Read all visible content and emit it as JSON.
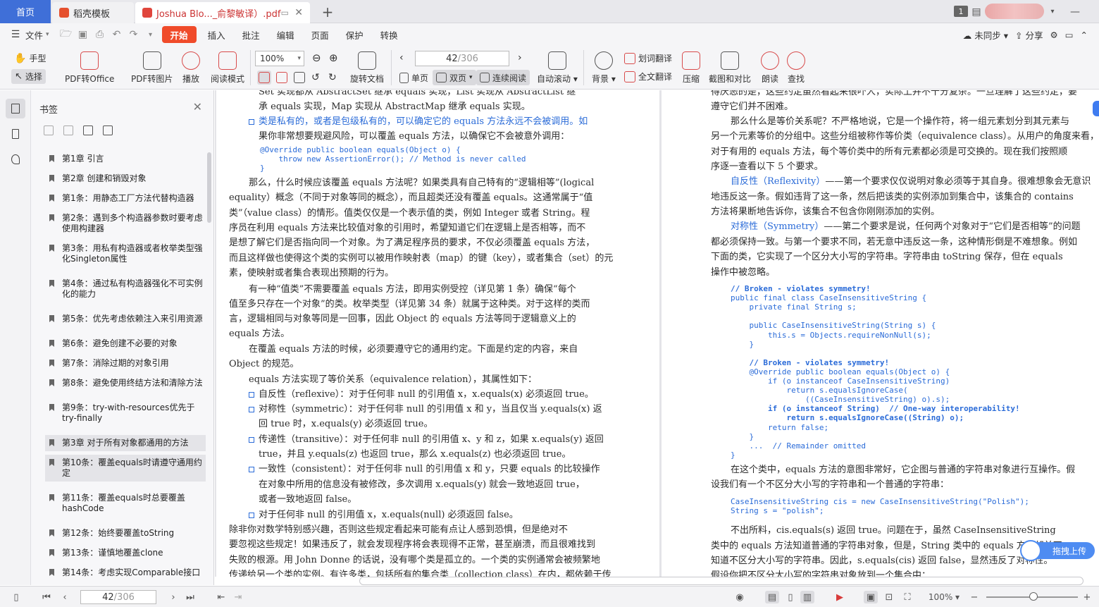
{
  "tabs": {
    "home": "首页",
    "templates": "稻壳模板",
    "document": "Joshua Blo..._俞黎敏译）.pdf",
    "window_count": "1"
  },
  "menu": {
    "file": "文件",
    "items": [
      "开始",
      "插入",
      "批注",
      "编辑",
      "页面",
      "保护",
      "转换"
    ],
    "active": "开始",
    "sync": "未同步",
    "share": "分享"
  },
  "ribbon": {
    "hand": "手型",
    "select": "选择",
    "pdf_to_office": "PDF转Office",
    "pdf_to_image": "PDF转图片",
    "play": "播放",
    "read_mode": "阅读模式",
    "zoom": "100%",
    "rotate": "旋转文档",
    "single": "单页",
    "double": "双页",
    "continuous": "连续阅读",
    "auto_scroll": "自动滚动",
    "background": "背景",
    "word_translate": "划词翻译",
    "full_translate": "全文翻译",
    "compress": "压缩",
    "screenshot": "截图和对比",
    "read_aloud": "朗读",
    "find": "查找",
    "page_current": "42",
    "page_total": "/306"
  },
  "bookmarks": {
    "title": "书签",
    "items": [
      "第1章 引言",
      "第2章 创建和销毁对象",
      "第1条：用静态工厂方法代替构造器",
      "第2条：遇到多个构造器参数时要考虑使用构建器",
      "第3条：用私有构造器或者枚举类型强化Singleton属性",
      "第4条：通过私有构造器强化不可实例化的能力",
      "第5条：优先考虑依赖注入来引用资源",
      "第6条：避免创建不必要的对象",
      "第7条：消除过期的对象引用",
      "第8条：避免使用终结方法和清除方法",
      "第9条：try-with-resources优先于try-finally",
      "第3章 对于所有对象都通用的方法",
      "第10条：覆盖equals时请遵守通用约定",
      "第11条：覆盖equals时总要覆盖hashCode",
      "第12条：始终要覆盖toString",
      "第13条：谨慎地覆盖clone",
      "第14条：考虑实现Comparable接口"
    ],
    "selected_index": 12
  },
  "left_page": {
    "lines": [
      "Set 实现都从 AbstractSet 继承 equals 实现，List 实现从 AbstractList 继",
      "承 equals 实现，Map 实现从 AbstractMap 继承 equals 实现。",
      "类是私有的，或者是包级私有的，可以确定它的 equals 方法永远不会被调用。如",
      "果你非常想要规避风险，可以覆盖 equals 方法，以确保它不会被意外调用：",
      "那么，什么时候应该覆盖 equals 方法呢？如果类具有自己特有的“逻辑相等”(logical",
      "equality）概念（不同于对象等同的概念），而且超类还没有覆盖 equals。这通常属于“值",
      "类”（value class）的情形。值类仅仅是一个表示值的类，例如 Integer 或者 String。程",
      "序员在利用 equals 方法来比较值对象的引用时，希望知道它们在逻辑上是否相等，而不",
      "是想了解它们是否指向同一个对象。为了满足程序员的要求，不仅必须覆盖 equals 方法，",
      "而且这样做也使得这个类的实例可以被用作映射表（map）的键（key），或者集合（set）的元",
      "素，使映射或者集合表现出预期的行为。",
      "有一种“值类”不需要覆盖 equals 方法，即用实例受控（详见第 1 条）确保“每个",
      "值至多只存在一个对象”的类。枚举类型（详见第 34 条）就属于这种类。对于这样的类而",
      "言，逻辑相同与对象等同是一回事，因此 Object 的 equals 方法等同于逻辑意义上的",
      "equals 方法。",
      "在覆盖 equals 方法的时候，必须要遵守它的通用约定。下面是约定的内容，来自",
      "Object 的规范。",
      "equals 方法实现了等价关系（equivalence relation），其属性如下：",
      "自反性（reflexive）：对于任何非 null 的引用值 x，x.equals(x) 必须返回 true。",
      "对称性（symmetric）：对于任何非 null 的引用值 x 和 y，当且仅当 y.equals(x) 返",
      "回 true 时，x.equals(y) 必须返回 true。",
      "传递性（transitive）：对于任何非 null 的引用值 x、y 和 z，如果 x.equals(y) 返回",
      "true，并且 y.equals(z) 也返回 true，那么 x.equals(z) 也必须返回 true。",
      "一致性（consistent）：对于任何非 null 的引用值 x 和 y，只要 equals 的比较操作",
      "在对象中所用的信息没有被修改，多次调用 x.equals(y) 就会一致地返回 true，",
      "或者一致地返回 false。",
      "对于任何非 null 的引用值 x，x.equals(null) 必须返回 false。",
      "除非你对数学特别感兴趣，否则这些规定看起来可能有点让人感到恐惧，但是绝对不",
      "要忽视这些规定！如果违反了，就会发现程序将会表现得不正常，甚至崩溃，而且很难找到",
      "失败的根源。用 John Donne 的话说，没有哪个类是孤立的。一个类的实例通常会被频繁地",
      "传递给另一个类的实例。有许多类，包括所有的集合类（collection class）在内，都依赖于传"
    ],
    "code": [
      "@Override public boolean equals(Object o) {",
      "    throw new AssertionError(); // Method is never called",
      "}"
    ]
  },
  "right_page": {
    "lines": [
      "得厌恶的是，这些约定虽然看起来很吓人，实际上并不十分复杂。一旦理解了这些约定，要",
      "遵守它们并不困难。",
      "那么什么是等价关系呢？不严格地说，它是一个操作符，将一组元素划分到其元素与",
      "另一个元素等价的分组中。这些分组被称作等价类（equivalence class）。从用户的角度来看，",
      "对于有用的 equals 方法，每个等价类中的所有元素都必须是可交换的。现在我们按照顺",
      "序逐一查看以下 5 个要求。",
      "自反性（Reflexivity）——第一个要求仅仅说明对象必须等于其自身。很难想象会无意识",
      "地违反这一条。假如违背了这一条，然后把该类的实例添加到集合中，该集合的 contains",
      "方法将果断地告诉你，该集合不包含你刚刚添加的实例。",
      "对称性（Symmetry）——第二个要求是说，任何两个对象对于“它们是否相等”的问题",
      "都必须保持一致。与第一个要求不同，若无意中违反这一条，这种情形倒是不难想象。例如",
      "下面的类，它实现了一个区分大小写的字符串。字符串由 toString 保存，但在 equals",
      "操作中被忽略。",
      "在这个类中，equals 方法的意图非常好，它企图与普通的字符串对象进行互操作。假",
      "设我们有一个不区分大小写的字符串和一个普通的字符串：",
      "不出所料，cis.equals(s) 返回 true。问题在于，虽然 CaseInsensitiveString",
      "类中的 equals 方法知道普通的字符串对象，但是，String 类中的 equals 方法却并不",
      "知道不区分大小写的字符串。因此，s.equals(cis) 返回 false，显然违反了对称性。",
      "假设你把不区分大小写的字符串对象放到一个集合中："
    ],
    "code1": [
      "// Broken - violates symmetry!",
      "public final class CaseInsensitiveString {",
      "    private final String s;",
      "",
      "    public CaseInsensitiveString(String s) {",
      "        this.s = Objects.requireNonNull(s);",
      "    }",
      "",
      "    // Broken - violates symmetry!",
      "    @Override public boolean equals(Object o) {",
      "        if (o instanceof CaseInsensitiveString)",
      "            return s.equalsIgnoreCase(",
      "                ((CaseInsensitiveString) o).s);",
      "        if (o instanceof String)  // One-way interoperability!",
      "            return s.equalsIgnoreCase((String) o);",
      "        return false;",
      "    }",
      "    ...  // Remainder omitted",
      "}"
    ],
    "code2": [
      "CaseInsensitiveString cis = new CaseInsensitiveString(\"Polish\");",
      "String s = \"polish\";"
    ]
  },
  "float": {
    "upload": "拖拽上传"
  },
  "status": {
    "page_current": "42",
    "page_total": "/306",
    "zoom": "100%"
  },
  "colors": {
    "accent": "#f04b2a",
    "home_tab": "#3f6fd8",
    "code_blue": "#2a6bd8"
  }
}
